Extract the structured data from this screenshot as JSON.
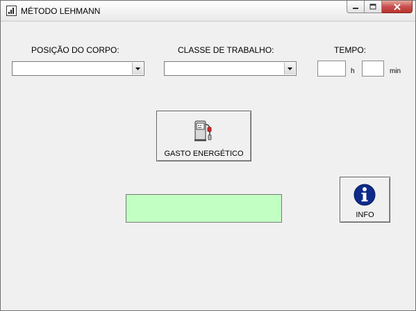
{
  "window": {
    "title": "MÉTODO LEHMANN",
    "controls": [
      "minimize-icon",
      "maximize-icon",
      "close-icon"
    ]
  },
  "form": {
    "posture_label": "POSIÇÃO DO CORPO:",
    "posture_value": "",
    "work_class_label": "CLASSE DE TRABALHO:",
    "work_class_value": "",
    "time_label": "TEMPO:",
    "hours_value": "",
    "hours_unit": "h",
    "minutes_value": "",
    "minutes_unit": "min"
  },
  "buttons": {
    "energy_label": "GASTO ENERGÉTICO",
    "energy_icon": "fuel-pump-icon",
    "info_label": "INFO",
    "info_icon": "info-icon"
  },
  "result": {
    "value": "",
    "color": "#c2ffc2"
  }
}
